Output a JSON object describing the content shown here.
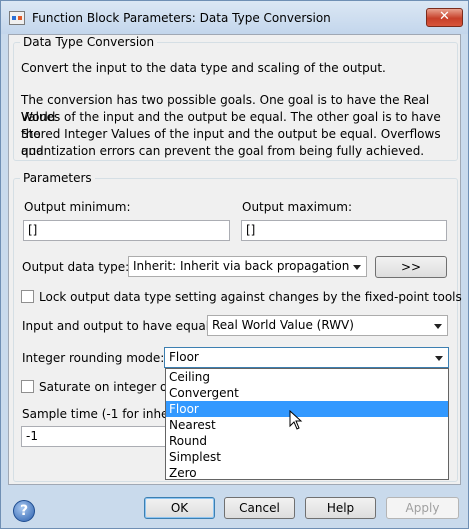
{
  "window": {
    "title": "Function Block Parameters: Data Type Conversion",
    "close_label": "✕"
  },
  "block": {
    "legend": "Data Type Conversion",
    "description_1": "Convert the input to the data type and scaling of the output.",
    "description_2_l1": "The conversion has two possible goals. One goal is to have the Real World",
    "description_2_l2": "Values of the input and the output be equal.  The other goal is to have the",
    "description_2_l3": "Stored Integer Values of the input and the output be equal.  Overflows and",
    "description_2_l4": "quantization errors can prevent the goal from being fully achieved."
  },
  "params": {
    "legend": "Parameters",
    "output_min_label": "Output minimum:",
    "output_min_value": "[]",
    "output_max_label": "Output maximum:",
    "output_max_value": "[]",
    "data_type_label": "Output data type:",
    "data_type_value": "Inherit: Inherit via back propagation",
    "assistant_button": ">>",
    "lock_label": "Lock output data type setting against changes by the fixed-point tools",
    "equal_label": "Input and output to have equal:",
    "equal_value": "Real World Value (RWV)",
    "rounding_label": "Integer rounding mode:",
    "rounding_value": "Floor",
    "saturate_label": "Saturate on integer ov",
    "sample_label": "Sample time (-1 for inhe",
    "sample_value": "-1"
  },
  "rounding_options": [
    "Ceiling",
    "Convergent",
    "Floor",
    "Nearest",
    "Round",
    "Simplest",
    "Zero"
  ],
  "rounding_selected": "Floor",
  "buttons": {
    "ok": "OK",
    "cancel": "Cancel",
    "help": "Help",
    "apply": "Apply"
  },
  "icons": {
    "help_glyph": "?"
  }
}
